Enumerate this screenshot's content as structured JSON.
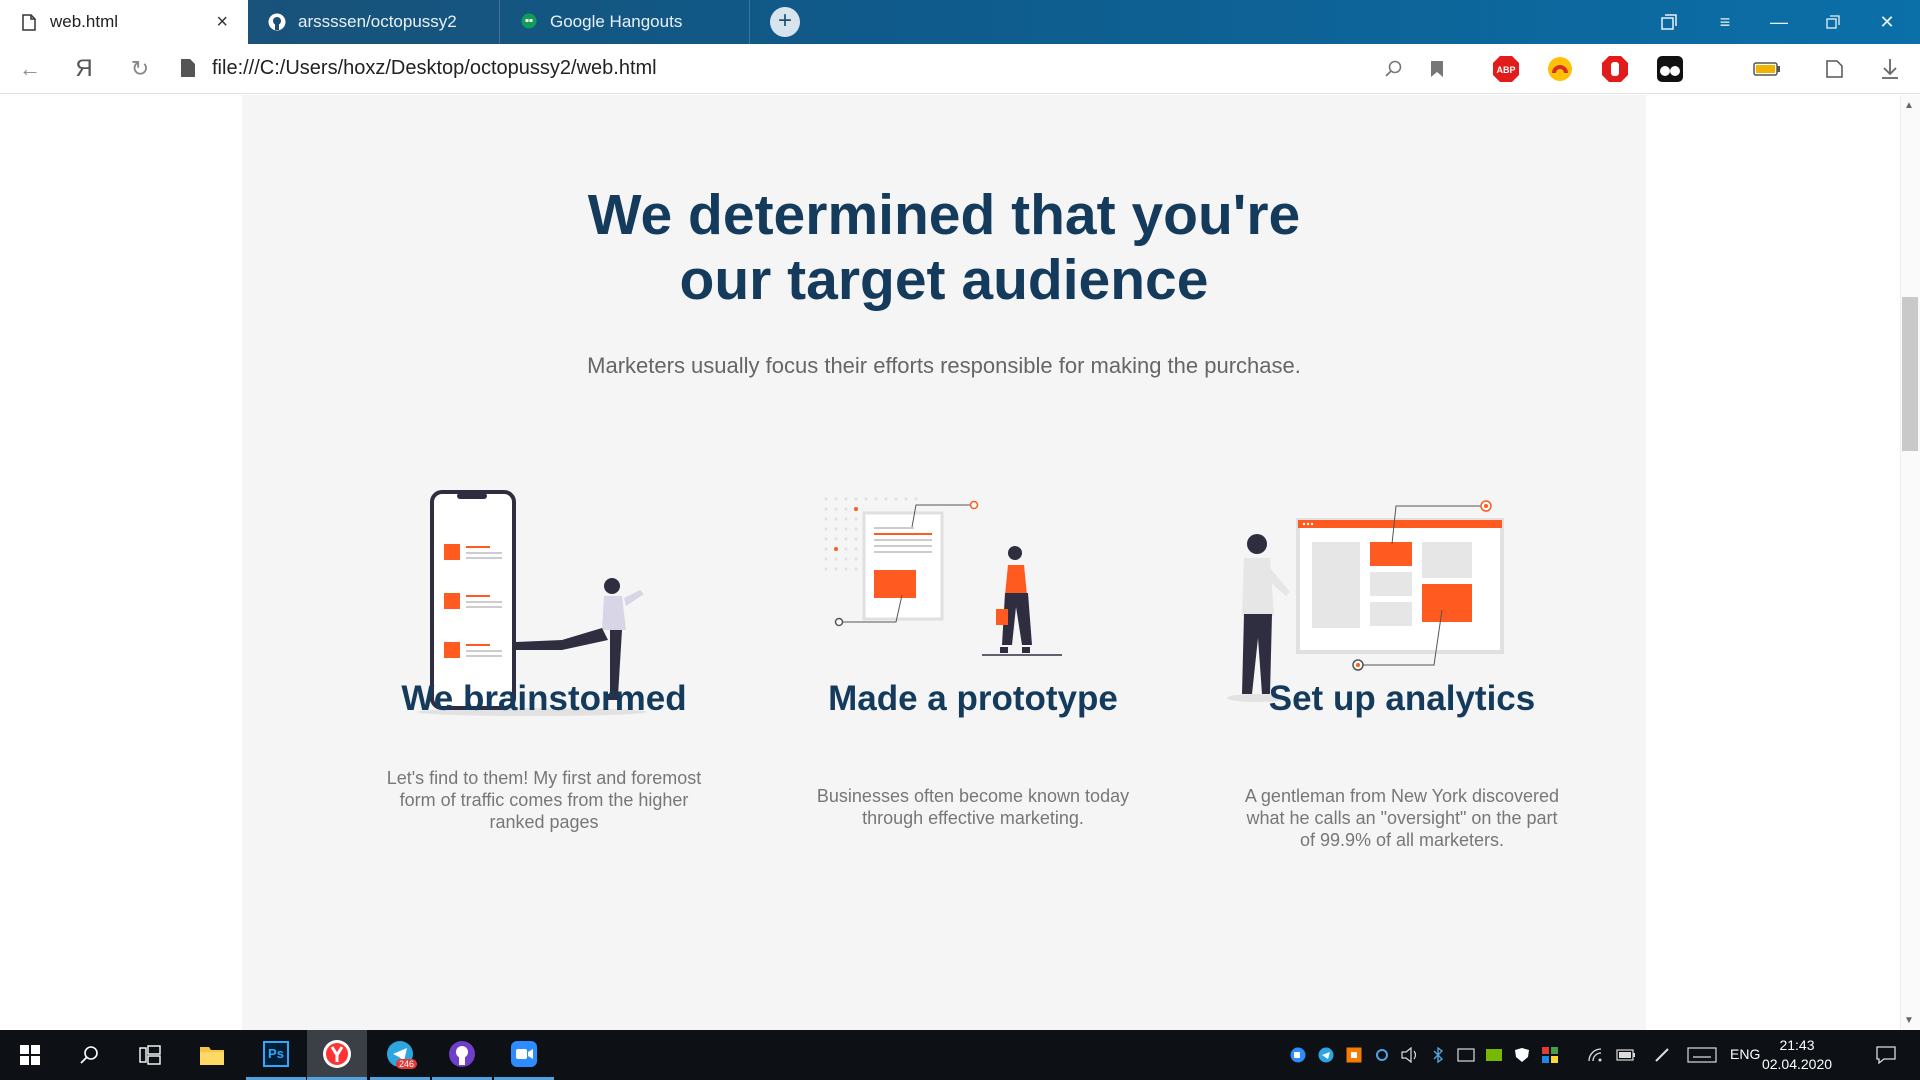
{
  "browser": {
    "tabs": [
      {
        "title": "web.html",
        "icon": "file-icon",
        "active": true
      },
      {
        "title": "arssssen/octopussy2",
        "icon": "github-icon"
      },
      {
        "title": "Google Hangouts",
        "icon": "hangouts-icon"
      }
    ],
    "url": "file:///C:/Users/hoxz/Desktop/octopussy2/web.html",
    "extensions": [
      "abp-icon",
      "vpn-icon",
      "block-icon",
      "glasses-icon"
    ],
    "abp_label": "ABP"
  },
  "page": {
    "headline_line1": "We determined that you're",
    "headline_line2": "our target audience",
    "subheadline": "Marketers usually focus their efforts responsible for making the purchase.",
    "features": [
      {
        "title": "We brainstormed",
        "text": "Let's find to them! My first and foremost form of traffic comes from the higher ranked pages",
        "illustration": "phone-person-illustration"
      },
      {
        "title": "Made a prototype",
        "text": "Businesses often become known today through effective marketing.",
        "illustration": "prototype-woman-illustration"
      },
      {
        "title": "Set up analytics",
        "text": "A gentleman from New York discovered what he calls an \"oversight\" on the part of 99.9% of all marketers.",
        "illustration": "analytics-man-illustration"
      }
    ],
    "colors": {
      "accent": "#ff5a1f",
      "heading": "#143a5c",
      "background": "#f5f5f5"
    }
  },
  "taskbar": {
    "apps": [
      "windows-start-icon",
      "search-icon",
      "task-view-icon",
      "file-explorer-icon",
      "photoshop-icon",
      "yandex-browser-icon",
      "telegram-icon",
      "github-desktop-icon",
      "zoom-icon"
    ],
    "photoshop_label": "Ps",
    "telegram_badge": "246",
    "language": "ENG",
    "time": "21:43",
    "date": "02.04.2020"
  }
}
